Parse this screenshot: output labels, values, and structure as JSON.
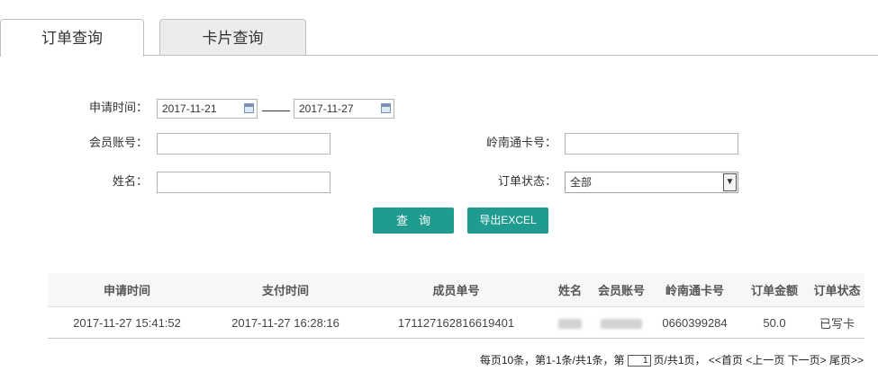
{
  "tabs": [
    {
      "label": "订单查询",
      "active": true
    },
    {
      "label": "卡片查询",
      "active": false
    }
  ],
  "form": {
    "apply_time_label": "申请时间：",
    "start_date": "2017-11-21",
    "end_date": "2017-11-27",
    "member_account_label": "会员账号：",
    "member_account_value": "",
    "lingnan_card_label": "岭南通卡号：",
    "lingnan_card_value": "",
    "name_label": "姓名：",
    "name_value": "",
    "order_status_label": "订单状态：",
    "order_status_value": "全部"
  },
  "buttons": {
    "search": "查询",
    "export": "导出EXCEL"
  },
  "table": {
    "headers": [
      "申请时间",
      "支付时间",
      "成员单号",
      "姓名",
      "会员账号",
      "岭南通卡号",
      "订单金额",
      "订单状态"
    ],
    "rows": [
      {
        "apply_time": "2017-11-27 15:41:52",
        "pay_time": "2017-11-27 16:28:16",
        "member_order_no": "171127162816619401",
        "card_no": "0660399284",
        "amount": "50.0",
        "status": "已写卡"
      }
    ]
  },
  "pager": {
    "summary": "每页10条，第1-1条/共1条，第",
    "page_input": "1",
    "total": "页/共1页，",
    "first": "<<首页",
    "prev": "<上一页",
    "next": "下一页>",
    "last": "尾页>>"
  },
  "colors": {
    "accent": "#1f9b90",
    "tab_inactive_bg": "#ececec",
    "table_header_bg": "#f7f7f7"
  }
}
